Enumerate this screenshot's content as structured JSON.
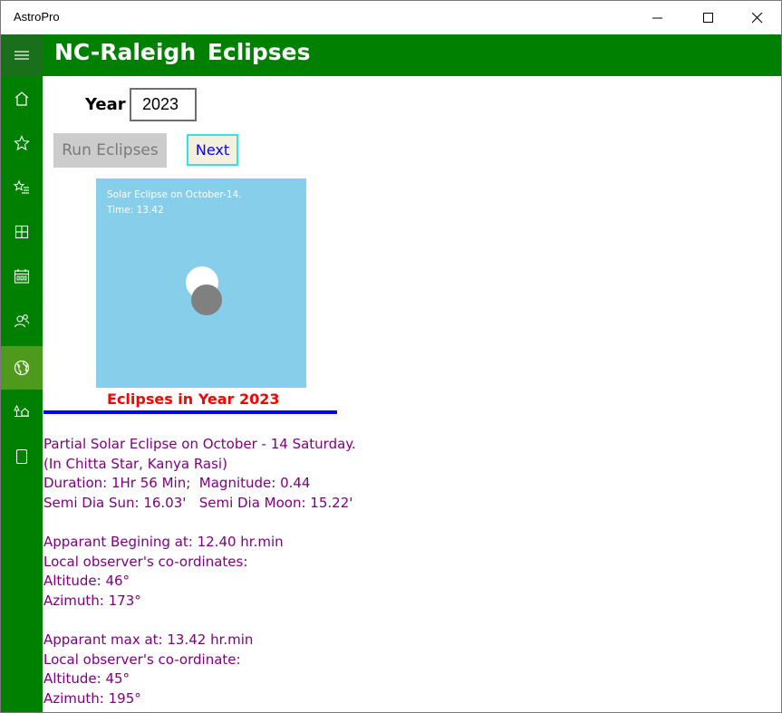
{
  "window": {
    "title": "AstroPro",
    "minimize_icon": "minimize-icon",
    "maximize_icon": "maximize-icon",
    "close_icon": "close-icon"
  },
  "header": {
    "title": "NC-Raleigh  Eclipses",
    "background": "#008000"
  },
  "sidebar": {
    "menu_icon": "hamburger-icon",
    "items": [
      {
        "icon": "home-icon"
      },
      {
        "icon": "star-icon"
      },
      {
        "icon": "star-list-icon"
      },
      {
        "icon": "grid-icon"
      },
      {
        "icon": "calendar-icon"
      },
      {
        "icon": "people-icon"
      },
      {
        "icon": "globe-icon",
        "active": true
      },
      {
        "icon": "house-tree-icon"
      },
      {
        "icon": "tablet-icon"
      }
    ]
  },
  "form": {
    "year_label": "Year",
    "year_value": "2023",
    "run_label": "Run Eclipses",
    "next_label": "Next"
  },
  "eclipse_panel": {
    "caption_line1": "Solar Eclipse on October-14.",
    "caption_line2": "Time: 13.42",
    "background": "#87ceeb",
    "magnitude": 0.44
  },
  "results": {
    "heading": "Eclipses in Year 2023",
    "lines": [
      "Partial Solar Eclipse on October - 14 Saturday.",
      "(In Chitta Star, Kanya Rasi)",
      "Duration: 1Hr 56 Min;  Magnitude: 0.44",
      "Semi Dia Sun: 16.03'   Semi Dia Moon: 15.22'",
      "",
      "Apparant Begining at: 12.40 hr.min",
      "Local observer's co-ordinates:",
      "Altitude: 46°",
      "Azimuth: 173°",
      "",
      "Apparant max at: 13.42 hr.min",
      "Local observer's co-ordinate:",
      "Altitude: 45°",
      "Azimuth: 195°"
    ]
  }
}
